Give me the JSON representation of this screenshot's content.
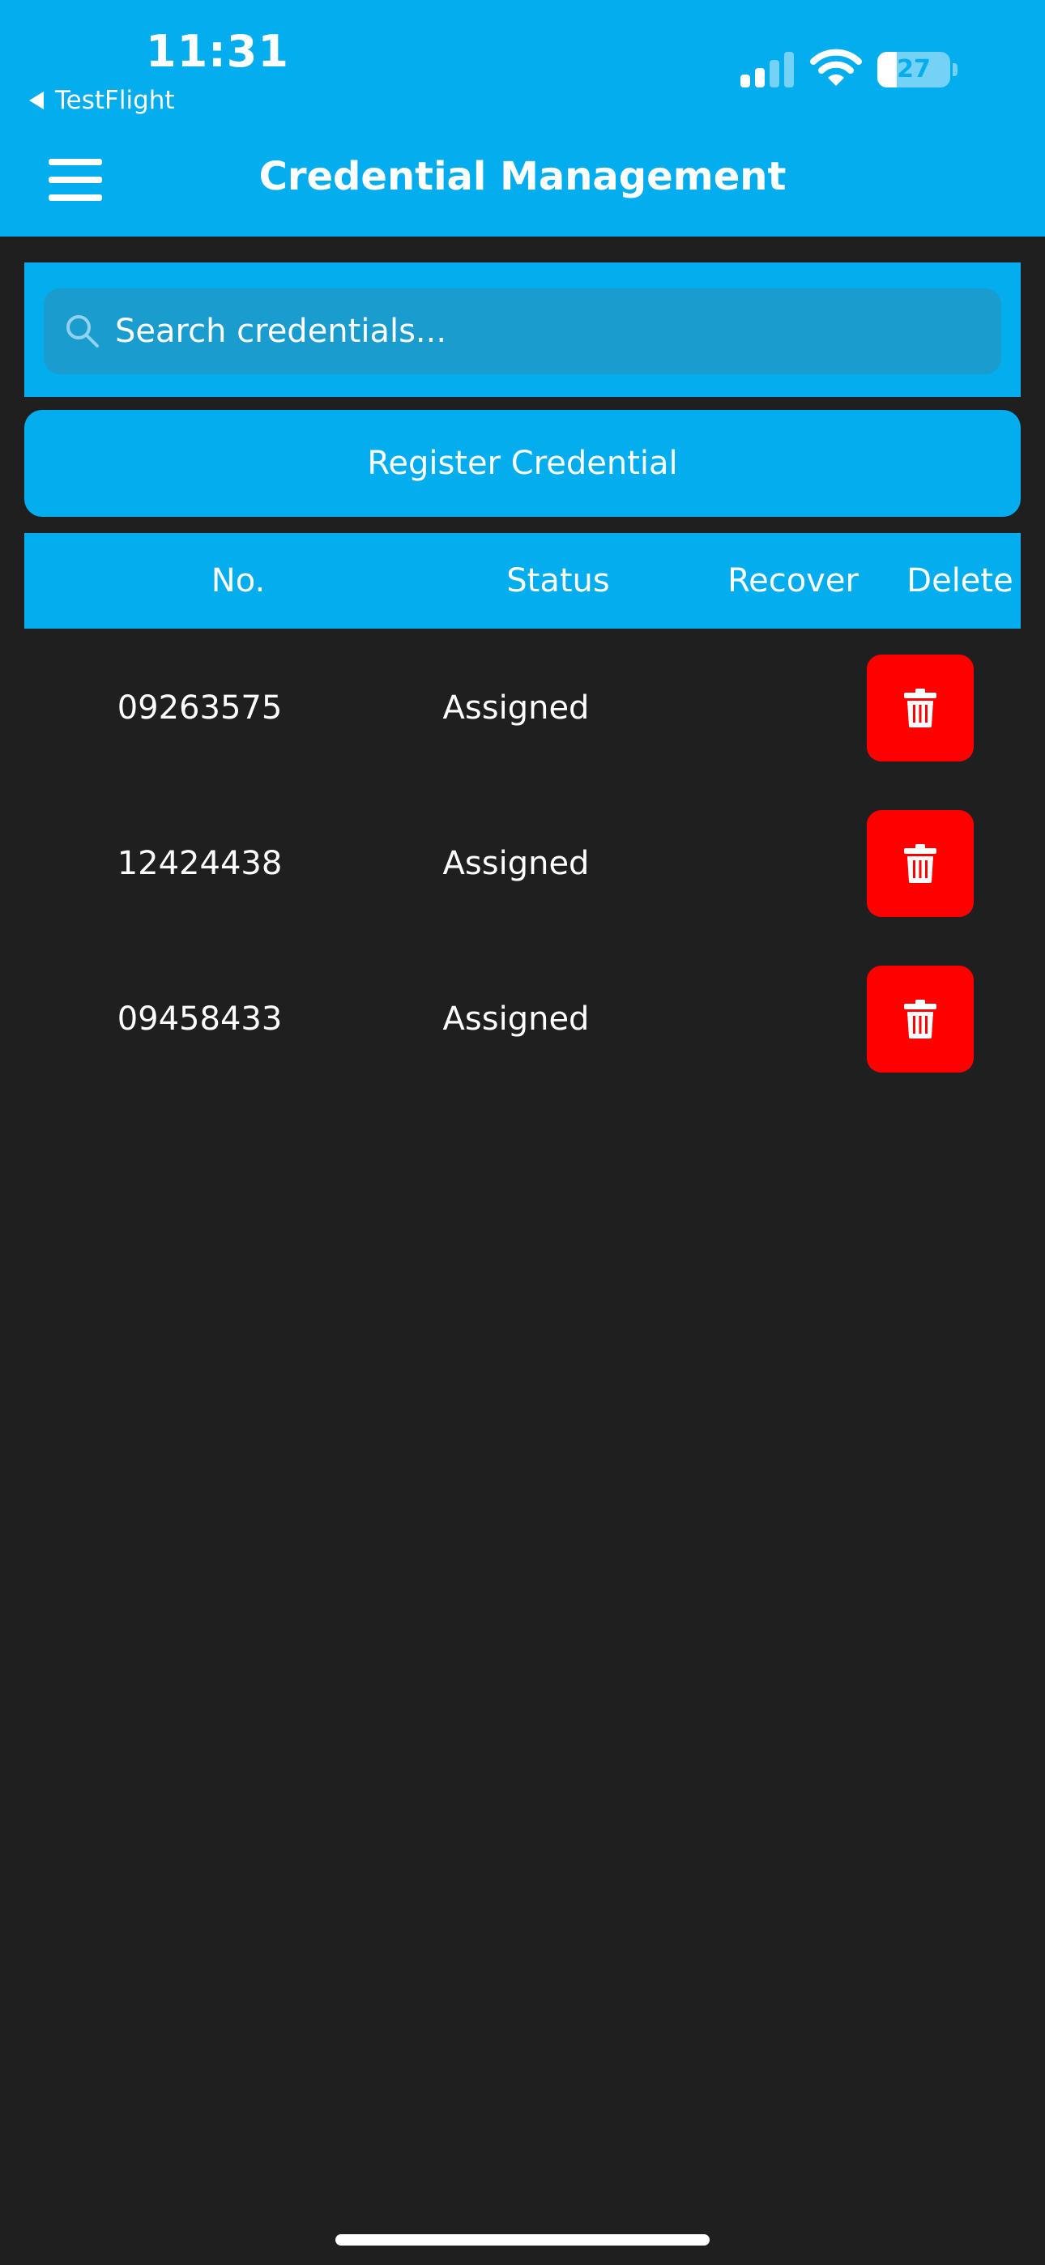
{
  "status_bar": {
    "time": "11:31",
    "back_app": "TestFlight",
    "battery_level": "27",
    "battery_fraction": 0.27,
    "signal_bars_active": 2
  },
  "header": {
    "title": "Credential Management",
    "background": "#03adee"
  },
  "search": {
    "placeholder": "Search credentials..."
  },
  "actions": {
    "register_label": "Register Credential"
  },
  "table": {
    "columns": [
      "No.",
      "Status",
      "Recover",
      "Delete"
    ],
    "rows": [
      {
        "no": "09263575",
        "status": "Assigned",
        "recover": ""
      },
      {
        "no": "12424438",
        "status": "Assigned",
        "recover": ""
      },
      {
        "no": "09458433",
        "status": "Assigned",
        "recover": ""
      }
    ],
    "delete_button_color": "#ff0000",
    "delete_icon": "trash-icon"
  }
}
